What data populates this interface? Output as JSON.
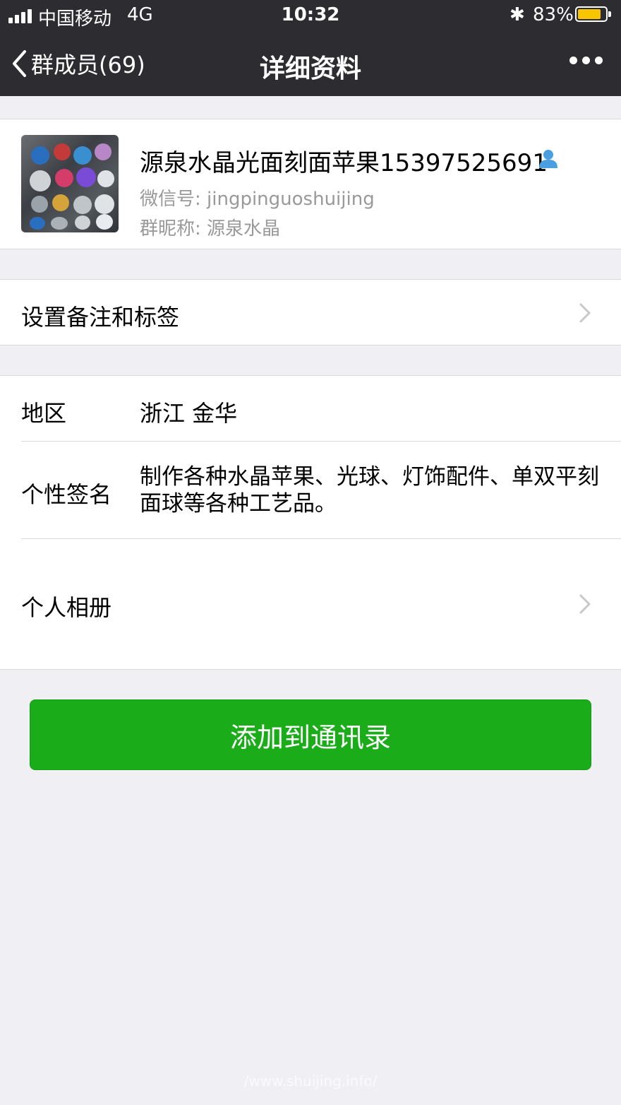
{
  "status_bar": {
    "carrier": "中国移动",
    "network": "4G",
    "time": "10:32",
    "bluetooth": "✱",
    "battery_percent": "83%",
    "battery_level": 0.83,
    "battery_color": "#f7c600"
  },
  "nav": {
    "back_label": "群成员(69)",
    "title": "详细资料",
    "more_icon": "more-dots-icon"
  },
  "profile": {
    "name": "源泉水晶光面刻面苹果15397525691",
    "wechat_id": "微信号:  jingpinguoshuijing",
    "group_nickname": "群昵称:  源泉水晶",
    "contact_icon": "contact-person-icon"
  },
  "remark": {
    "label": "设置备注和标签"
  },
  "info": {
    "region_label": "地区",
    "region_value": "浙江 金华",
    "signature_label": "个性签名",
    "signature_value": "制作各种水晶苹果、光球、灯饰配件、单双平刻面球等各种工艺品。",
    "album_label": "个人相册"
  },
  "actions": {
    "add_contact_label": "添加到通讯录",
    "button_color": "#1aad19"
  },
  "watermark": "/www.shuijing.info/"
}
